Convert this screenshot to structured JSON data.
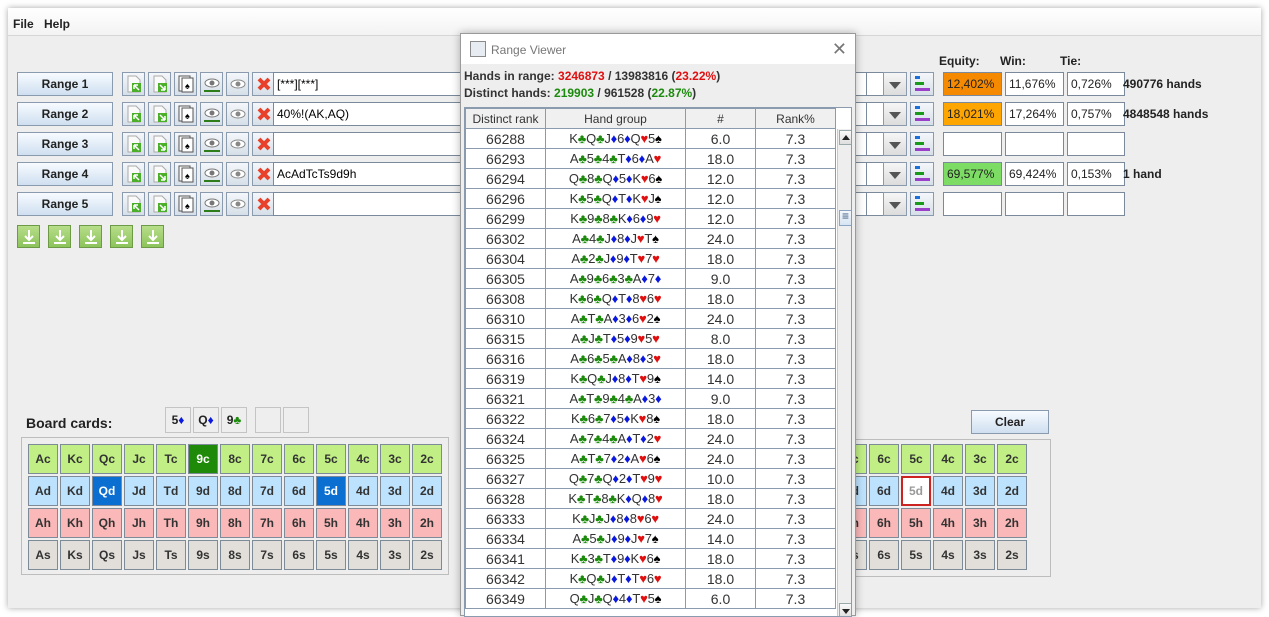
{
  "menu": [
    "File",
    "Help"
  ],
  "ranges": [
    {
      "label": "Range 1",
      "value": "[***][***]",
      "equity": "12,402%",
      "win": "11,676%",
      "tie": "0,726%",
      "hands": "490776 hands",
      "equity_color": "#f58a00"
    },
    {
      "label": "Range 2",
      "value": "40%!(AK,AQ)",
      "equity": "18,021%",
      "win": "17,264%",
      "tie": "0,757%",
      "hands": "4848548 hands",
      "equity_color": "#ffa500"
    },
    {
      "label": "Range 3",
      "value": "",
      "equity": "",
      "win": "",
      "tie": "",
      "hands": "",
      "equity_color": "#ffffff"
    },
    {
      "label": "Range 4",
      "value": "AcAdTcTs9d9h",
      "equity": "69,577%",
      "win": "69,424%",
      "tie": "0,153%",
      "hands": "1 hand",
      "equity_color": "#7ddc64"
    },
    {
      "label": "Range 5",
      "value": "",
      "equity": "",
      "win": "",
      "tie": "",
      "hands": "",
      "equity_color": "#ffffff"
    }
  ],
  "result_headers": {
    "equity": "Equity:",
    "win": "Win:",
    "tie": "Tie:"
  },
  "board": {
    "label": "Board cards:",
    "cards": [
      {
        "rank": "5",
        "suit": "d"
      },
      {
        "rank": "Q",
        "suit": "d"
      },
      {
        "rank": "9",
        "suit": "c"
      },
      {
        "rank": "",
        "suit": ""
      },
      {
        "rank": "",
        "suit": ""
      }
    ],
    "clear_label": "Clear"
  },
  "deck": {
    "ranks": [
      "A",
      "K",
      "Q",
      "J",
      "T",
      "9",
      "8",
      "7",
      "6",
      "5",
      "4",
      "3",
      "2"
    ],
    "suits": [
      "c",
      "d",
      "h",
      "s"
    ],
    "selected": [
      "9c",
      "Qd",
      "5d"
    ],
    "right_used": [
      "5d"
    ],
    "left_plain_9d": "9d"
  },
  "dialog": {
    "title": "Range Viewer",
    "hands_in_range_label": "Hands in range: ",
    "hands_in_range": "3246873",
    "hands_total": "13983816",
    "hands_pct": "23.22%",
    "distinct_label": "Distinct hands: ",
    "distinct": "219903",
    "distinct_total": "961528",
    "distinct_pct": "22.87%",
    "columns": [
      "Distinct rank",
      "Hand group",
      "#",
      "Rank%"
    ],
    "rows": [
      {
        "rank": "66288",
        "group": "KcQcJd6dQh5s",
        "count": "6.0",
        "pct": "7.3"
      },
      {
        "rank": "66293",
        "group": "Ac5c4cTd6dAh",
        "count": "18.0",
        "pct": "7.3"
      },
      {
        "rank": "66294",
        "group": "Qc8cQd5dKh6s",
        "count": "12.0",
        "pct": "7.3"
      },
      {
        "rank": "66296",
        "group": "Kc5cQdTdKhJs",
        "count": "12.0",
        "pct": "7.3"
      },
      {
        "rank": "66299",
        "group": "Kc9c8cKd6d9h",
        "count": "12.0",
        "pct": "7.3"
      },
      {
        "rank": "66302",
        "group": "Ac4cJd8dJhTs",
        "count": "24.0",
        "pct": "7.3"
      },
      {
        "rank": "66304",
        "group": "Ac2cJd9dTh7h",
        "count": "18.0",
        "pct": "7.3"
      },
      {
        "rank": "66305",
        "group": "Ac9c6c3cAd7d",
        "count": "9.0",
        "pct": "7.3"
      },
      {
        "rank": "66308",
        "group": "Kc6cQdTd8h6h",
        "count": "18.0",
        "pct": "7.3"
      },
      {
        "rank": "66310",
        "group": "AcTcAd3d6h2s",
        "count": "24.0",
        "pct": "7.3"
      },
      {
        "rank": "66315",
        "group": "AcJcTd5d9h5h",
        "count": "8.0",
        "pct": "7.3"
      },
      {
        "rank": "66316",
        "group": "Ac6c5cAd8d3h",
        "count": "18.0",
        "pct": "7.3"
      },
      {
        "rank": "66319",
        "group": "KcQcJd8dTh9s",
        "count": "14.0",
        "pct": "7.3"
      },
      {
        "rank": "66321",
        "group": "AcTc9c4cAd3d",
        "count": "9.0",
        "pct": "7.3"
      },
      {
        "rank": "66322",
        "group": "Kc6c7d5dKh8s",
        "count": "18.0",
        "pct": "7.3"
      },
      {
        "rank": "66324",
        "group": "Ac7c4cAdTd2h",
        "count": "24.0",
        "pct": "7.3"
      },
      {
        "rank": "66325",
        "group": "AcTc7d2dAh6s",
        "count": "24.0",
        "pct": "7.3"
      },
      {
        "rank": "66327",
        "group": "Qc7cQd2dTh9h",
        "count": "10.0",
        "pct": "7.3"
      },
      {
        "rank": "66328",
        "group": "KcTc8cKdQd8h",
        "count": "18.0",
        "pct": "7.3"
      },
      {
        "rank": "66333",
        "group": "KcJcJd8d8h6h",
        "count": "24.0",
        "pct": "7.3"
      },
      {
        "rank": "66334",
        "group": "Ac5cJd9dJh7s",
        "count": "14.0",
        "pct": "7.3"
      },
      {
        "rank": "66341",
        "group": "Kc3cTd9dKh6s",
        "count": "18.0",
        "pct": "7.3"
      },
      {
        "rank": "66342",
        "group": "KcQcJdTdTh6h",
        "count": "18.0",
        "pct": "7.3"
      },
      {
        "rank": "66349",
        "group": "QcJcQd4dTh5s",
        "count": "6.0",
        "pct": "7.3"
      }
    ]
  },
  "icons": {
    "import": "import-range-icon",
    "export": "export-range-icon",
    "cards": "card-picker-icon",
    "view": "view-range-icon",
    "view2": "view-range-alt-icon",
    "clear": "clear-range-icon",
    "download": "download-icon",
    "stats": "stats-bar-icon",
    "suits": {
      "c": "♣",
      "d": "♦",
      "h": "♥",
      "s": "♠"
    }
  }
}
